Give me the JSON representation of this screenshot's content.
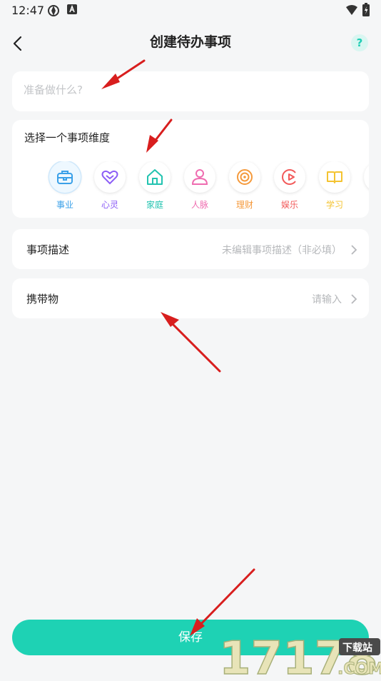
{
  "status_bar": {
    "time": "12:47"
  },
  "header": {
    "title": "创建待办事项",
    "help": "?"
  },
  "task_input": {
    "value": "",
    "placeholder": "准备做什么?"
  },
  "dimension": {
    "label": "选择一个事项维度",
    "items": [
      {
        "name": "事业",
        "color": "#3aa0e8",
        "icon": "briefcase-icon"
      },
      {
        "name": "心灵",
        "color": "#8b5cf6",
        "icon": "heart-icon"
      },
      {
        "name": "家庭",
        "color": "#22c3b0",
        "icon": "house-icon"
      },
      {
        "name": "人脉",
        "color": "#ef6cb0",
        "icon": "people-icon"
      },
      {
        "name": "理财",
        "color": "#f59a3c",
        "icon": "coin-icon"
      },
      {
        "name": "娱乐",
        "color": "#f25a5a",
        "icon": "play-icon"
      },
      {
        "name": "学习",
        "color": "#f4c330",
        "icon": "book-icon"
      }
    ]
  },
  "description_row": {
    "label": "事项描述",
    "value": "未编辑事项描述（非必填）"
  },
  "carry_row": {
    "label": "携带物",
    "value": "请输入"
  },
  "save_button": {
    "label": "保存"
  },
  "watermark": {
    "text": "17178",
    "badge": "下载站",
    "domain": ".COM"
  },
  "colors": {
    "accent": "#1ed2b4",
    "arrow": "#d81e1e"
  }
}
